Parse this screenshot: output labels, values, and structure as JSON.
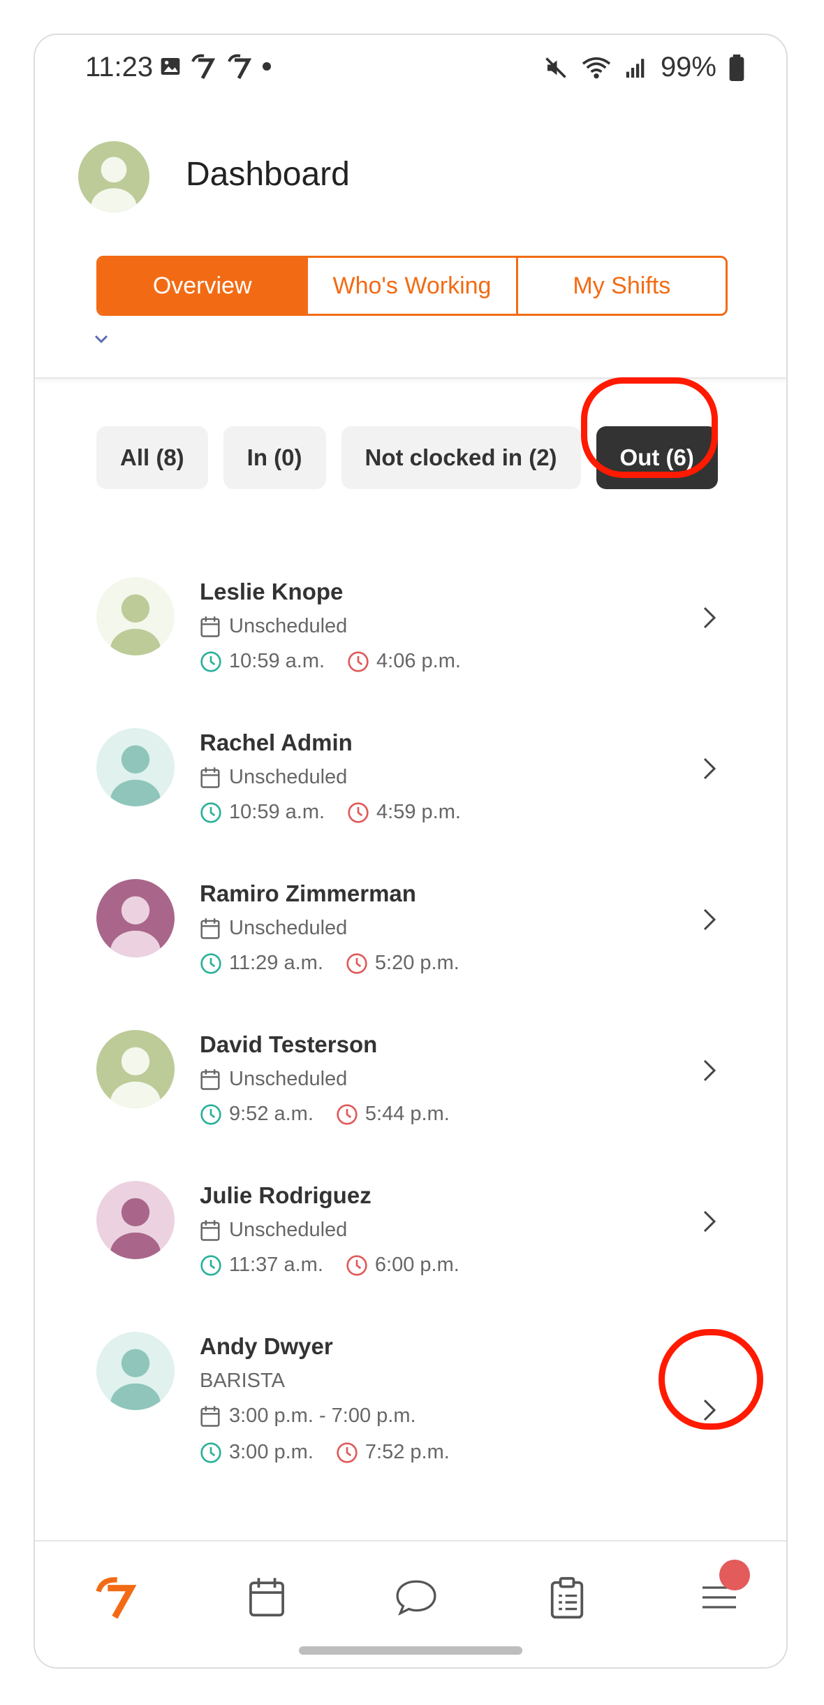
{
  "status_bar": {
    "time": "11:23",
    "battery": "99%"
  },
  "header": {
    "title": "Dashboard"
  },
  "tabs": [
    {
      "label": "Overview",
      "active": true
    },
    {
      "label": "Who's Working",
      "active": false
    },
    {
      "label": "My Shifts",
      "active": false
    }
  ],
  "filters": [
    {
      "label": "All (8)",
      "active": false
    },
    {
      "label": "In (0)",
      "active": false
    },
    {
      "label": "Not clocked in (2)",
      "active": false
    },
    {
      "label": "Out (6)",
      "active": true
    }
  ],
  "employees": [
    {
      "name": "Leslie Knope",
      "schedule": "Unscheduled",
      "clock_in": "10:59 a.m.",
      "clock_out": "4:06 p.m.",
      "avatar_bg": "#f3f7ec",
      "avatar_fg": "#bccb98"
    },
    {
      "name": "Rachel Admin",
      "schedule": "Unscheduled",
      "clock_in": "10:59 a.m.",
      "clock_out": "4:59 p.m.",
      "avatar_bg": "#e0f1ee",
      "avatar_fg": "#8fc5bb"
    },
    {
      "name": "Ramiro Zimmerman",
      "schedule": "Unscheduled",
      "clock_in": "11:29 a.m.",
      "clock_out": "5:20 p.m.",
      "avatar_bg": "#a9668a",
      "avatar_fg": "#ecd2e0"
    },
    {
      "name": "David Testerson",
      "schedule": "Unscheduled",
      "clock_in": "9:52 a.m.",
      "clock_out": "5:44 p.m.",
      "avatar_bg": "#bccb98",
      "avatar_fg": "#f3f7ec"
    },
    {
      "name": "Julie Rodriguez",
      "schedule": "Unscheduled",
      "clock_in": "11:37 a.m.",
      "clock_out": "6:00 p.m.",
      "avatar_bg": "#ecd2e0",
      "avatar_fg": "#a9668a"
    },
    {
      "name": "Andy Dwyer",
      "role": "BARISTA",
      "schedule": "3:00 p.m. - 7:00 p.m.",
      "clock_in": "3:00 p.m.",
      "clock_out": "7:52 p.m.",
      "avatar_bg": "#e0f1ee",
      "avatar_fg": "#8fc5bb"
    }
  ],
  "colors": {
    "accent": "#f26b14",
    "clock_in": "#2ab09a",
    "clock_out": "#e05a5a",
    "highlight": "#ff1a00"
  },
  "bottom_nav": [
    {
      "icon": "logo-icon"
    },
    {
      "icon": "calendar-icon"
    },
    {
      "icon": "chat-icon"
    },
    {
      "icon": "clipboard-icon"
    },
    {
      "icon": "menu-icon"
    }
  ]
}
